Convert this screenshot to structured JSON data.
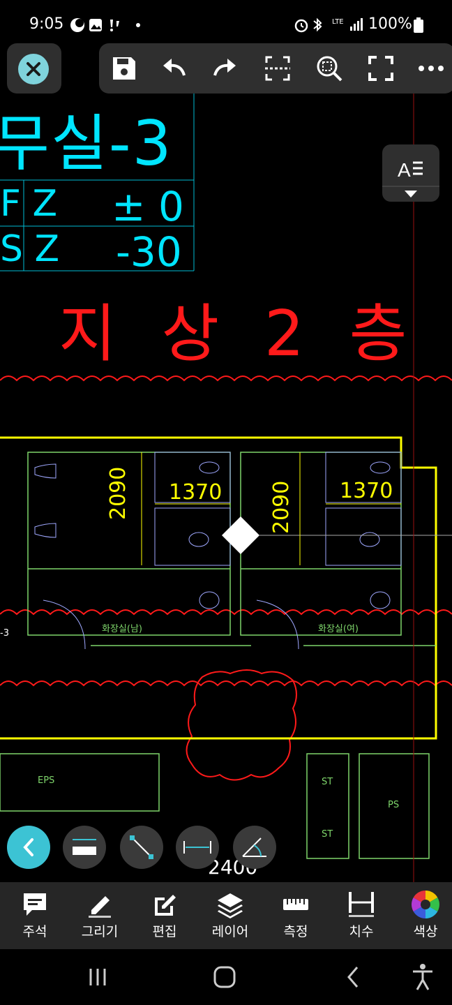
{
  "status_bar": {
    "time": "9:05",
    "left_icons": [
      "moon-icon",
      "gallery-icon",
      "notification-icon",
      "dot-icon"
    ],
    "right_icons": [
      "alarm-icon",
      "bluetooth-icon",
      "lte-icon",
      "signal-icon"
    ],
    "lte": "LTE",
    "battery": "100%"
  },
  "toolbar": {
    "icons": [
      "save-icon",
      "undo-icon",
      "redo-icon",
      "crop-area-icon",
      "zoom-fit-icon",
      "fullscreen-icon",
      "more-icon"
    ]
  },
  "drawing": {
    "title": "무실-3",
    "fz_label": "F Z",
    "fz_value": "± 0",
    "sz_label": "S Z",
    "sz_value": "-30",
    "floor_label": "지 상 2 층",
    "dim_height_left": "2090",
    "dim_width_left": "1370",
    "dim_height_right": "2090",
    "dim_width_right": "1370",
    "room_male": "화장실(남)",
    "room_female": "화장실(여)",
    "eps": "EPS",
    "st1": "ST",
    "st2": "ST",
    "ps": "PS",
    "bottom_dim": "2400",
    "side_mark": "-3"
  },
  "tools": {
    "items": [
      "measure-length-icon",
      "line-icon",
      "dimension-icon",
      "angle-icon"
    ]
  },
  "bottom_nav": {
    "items": [
      {
        "label": "주석",
        "icon": "comment-icon"
      },
      {
        "label": "그리기",
        "icon": "pencil-icon"
      },
      {
        "label": "편집",
        "icon": "edit-icon"
      },
      {
        "label": "레이어",
        "icon": "layers-icon"
      },
      {
        "label": "측정",
        "icon": "ruler-icon"
      },
      {
        "label": "치수",
        "icon": "dimension-icon"
      },
      {
        "label": "색상",
        "icon": "color-wheel-icon"
      }
    ]
  },
  "colors": {
    "accent": "#3cc3d4",
    "cad_cyan": "#00e5ff",
    "cad_red": "#ff1a1a",
    "cad_yellow": "#ffff00"
  }
}
